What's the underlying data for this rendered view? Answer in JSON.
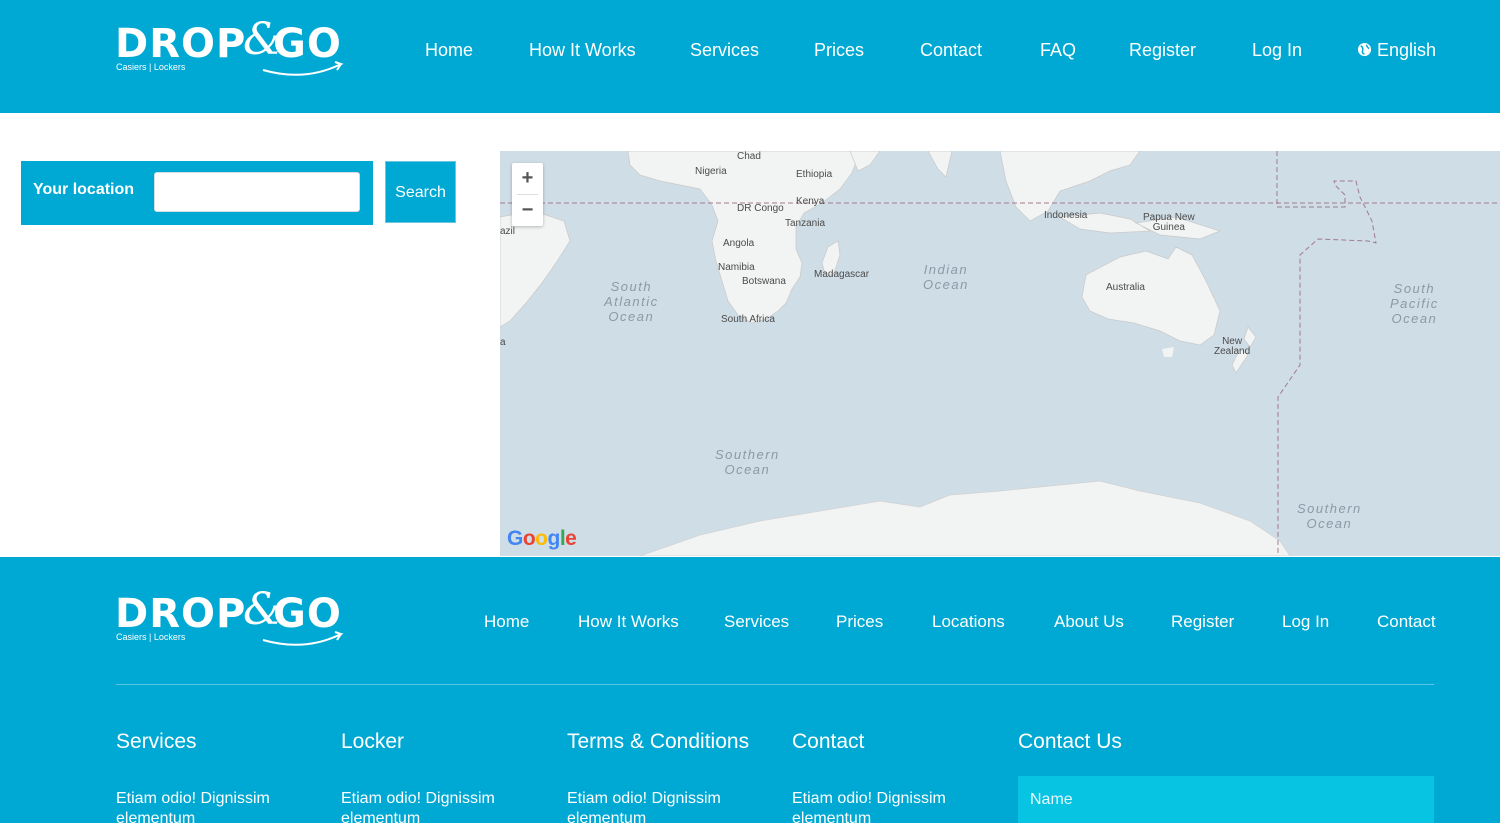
{
  "brand": {
    "word_left": "DROP",
    "ampersand": "&",
    "word_right": "GO",
    "tagline": "Casiers | Lockers"
  },
  "header": {
    "nav": [
      "Home",
      "How It Works",
      "Services",
      "Prices",
      "Contact",
      "FAQ",
      "Register",
      "Log In"
    ],
    "language": "English",
    "language_icon": "globe-icon"
  },
  "search": {
    "label": "Your location",
    "input_value": "",
    "button": "Search"
  },
  "map": {
    "zoom_in": "+",
    "zoom_out": "−",
    "provider_logo": "Google",
    "labels": {
      "chad": "Chad",
      "nigeria": "Nigeria",
      "ethiopia": "Ethiopia",
      "kenya": "Kenya",
      "drcongo": "DR Congo",
      "tanzania": "Tanzania",
      "angola": "Angola",
      "namibia": "Namibia",
      "botswana": "Botswana",
      "madagascar": "Madagascar",
      "southafrica": "South Africa",
      "indonesia": "Indonesia",
      "papua": "Papua New\nGuinea",
      "australia": "Australia",
      "newzealand": "New\nZealand",
      "azil": "azil",
      "a": "a"
    },
    "oceans": {
      "south_atlantic": "South\nAtlantic\nOcean",
      "indian": "Indian\nOcean",
      "south_pacific": "South\nPacific\nOcean",
      "southern1": "Southern\nOcean",
      "southern2": "Southern\nOcean"
    }
  },
  "footer": {
    "nav": [
      "Home",
      "How It Works",
      "Services",
      "Prices",
      "Locations",
      "About Us",
      "Register",
      "Log In",
      "Contact"
    ],
    "columns": [
      {
        "title": "Services",
        "text": "Etiam odio! Dignissim elementum"
      },
      {
        "title": "Locker",
        "text": "Etiam odio! Dignissim elementum"
      },
      {
        "title": "Terms & Conditions",
        "text": "Etiam odio! Dignissim elementum"
      },
      {
        "title": "Contact",
        "text": "Etiam odio! Dignissim elementum"
      }
    ],
    "contact_us": {
      "title": "Contact Us",
      "name_placeholder": "Name"
    }
  },
  "colors": {
    "primary": "#00a9d3",
    "input_bg": "#06c4e2",
    "map_water": "#cfdde6",
    "map_land": "#f2f3f3"
  }
}
